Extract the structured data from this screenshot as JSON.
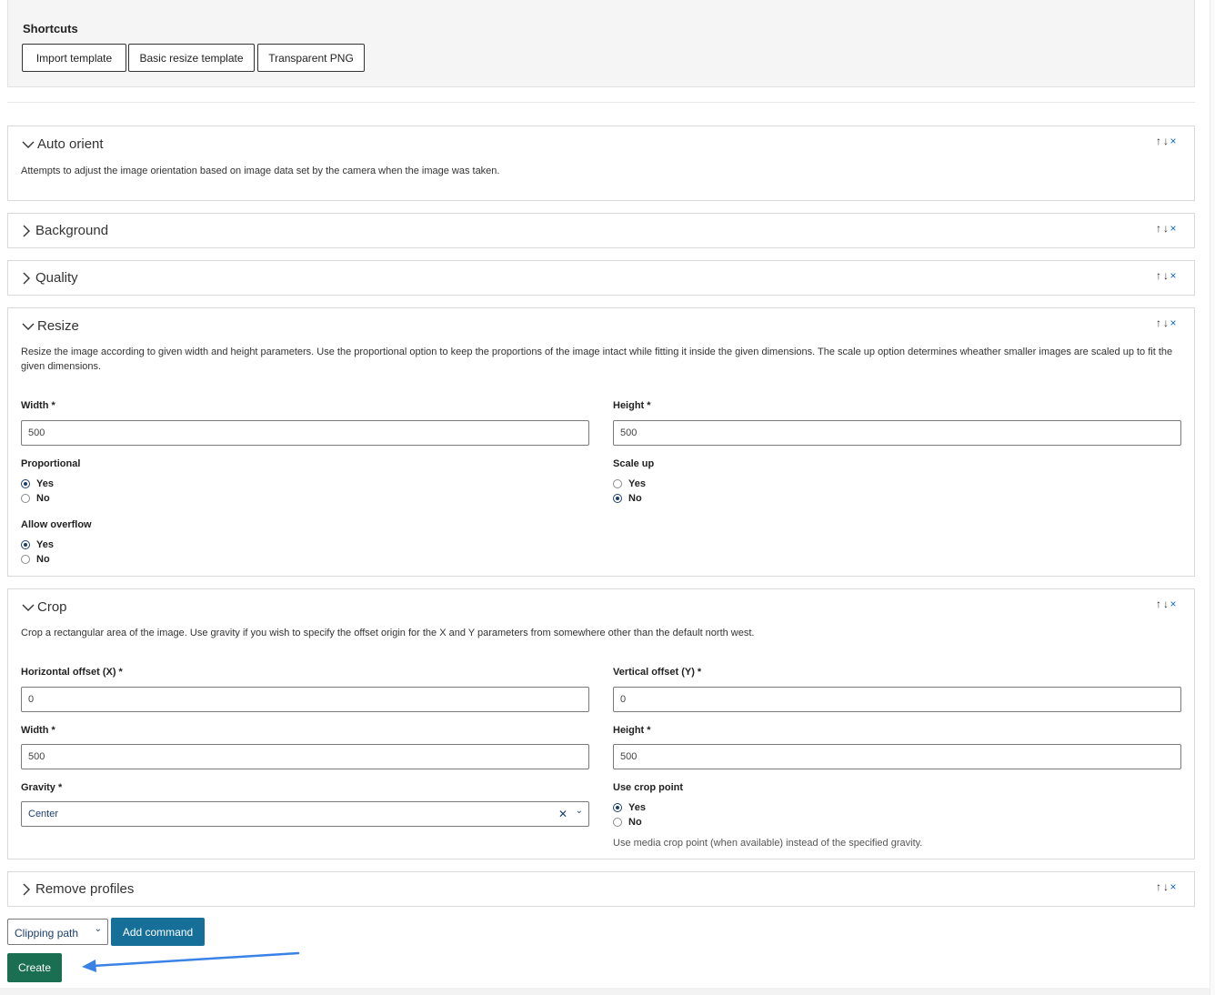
{
  "shortcuts": {
    "title": "Shortcuts",
    "buttons": [
      "Import template",
      "Basic resize template",
      "Transparent PNG"
    ]
  },
  "panel_controls": {
    "up": "↑",
    "down": "↓",
    "remove": "×"
  },
  "commands": {
    "auto_orient": {
      "title": "Auto orient",
      "expanded": true,
      "description": "Attempts to adjust the image orientation based on image data set by the camera when the image was taken."
    },
    "background": {
      "title": "Background",
      "expanded": false
    },
    "quality": {
      "title": "Quality",
      "expanded": false
    },
    "resize": {
      "title": "Resize",
      "expanded": true,
      "description": "Resize the image according to given width and height parameters. Use the proportional option to keep the proportions of the image intact while fitting it inside the given dimensions. The scale up option determines wheather smaller images are scaled up to fit the given dimensions.",
      "width_label": "Width *",
      "width_value": "500",
      "height_label": "Height *",
      "height_value": "500",
      "proportional_label": "Proportional",
      "scale_up_label": "Scale up",
      "allow_overflow_label": "Allow overflow",
      "yes": "Yes",
      "no": "No",
      "proportional_selected": "Yes",
      "scale_up_selected": "No",
      "allow_overflow_selected": "Yes"
    },
    "crop": {
      "title": "Crop",
      "expanded": true,
      "description": "Crop a rectangular area of the image. Use gravity if you wish to specify the offset origin for the X and Y parameters from somewhere other than the default north west.",
      "x_label": "Horizontal offset (X) *",
      "x_value": "0",
      "y_label": "Vertical offset (Y) *",
      "y_value": "0",
      "width_label": "Width *",
      "width_value": "500",
      "height_label": "Height *",
      "height_value": "500",
      "gravity_label": "Gravity *",
      "gravity_value": "Center",
      "crop_point_label": "Use crop point",
      "yes": "Yes",
      "no": "No",
      "crop_point_selected": "Yes",
      "crop_point_hint": "Use media crop point (when available) instead of the specified gravity."
    },
    "remove_profiles": {
      "title": "Remove profiles",
      "expanded": false
    }
  },
  "footer": {
    "command_select_value": "Clipping path",
    "add_command_label": "Add command",
    "create_label": "Create"
  },
  "colors": {
    "add_button": "#166f99",
    "create_button": "#1a6e52",
    "arrow_annotation": "#3b82e6"
  }
}
